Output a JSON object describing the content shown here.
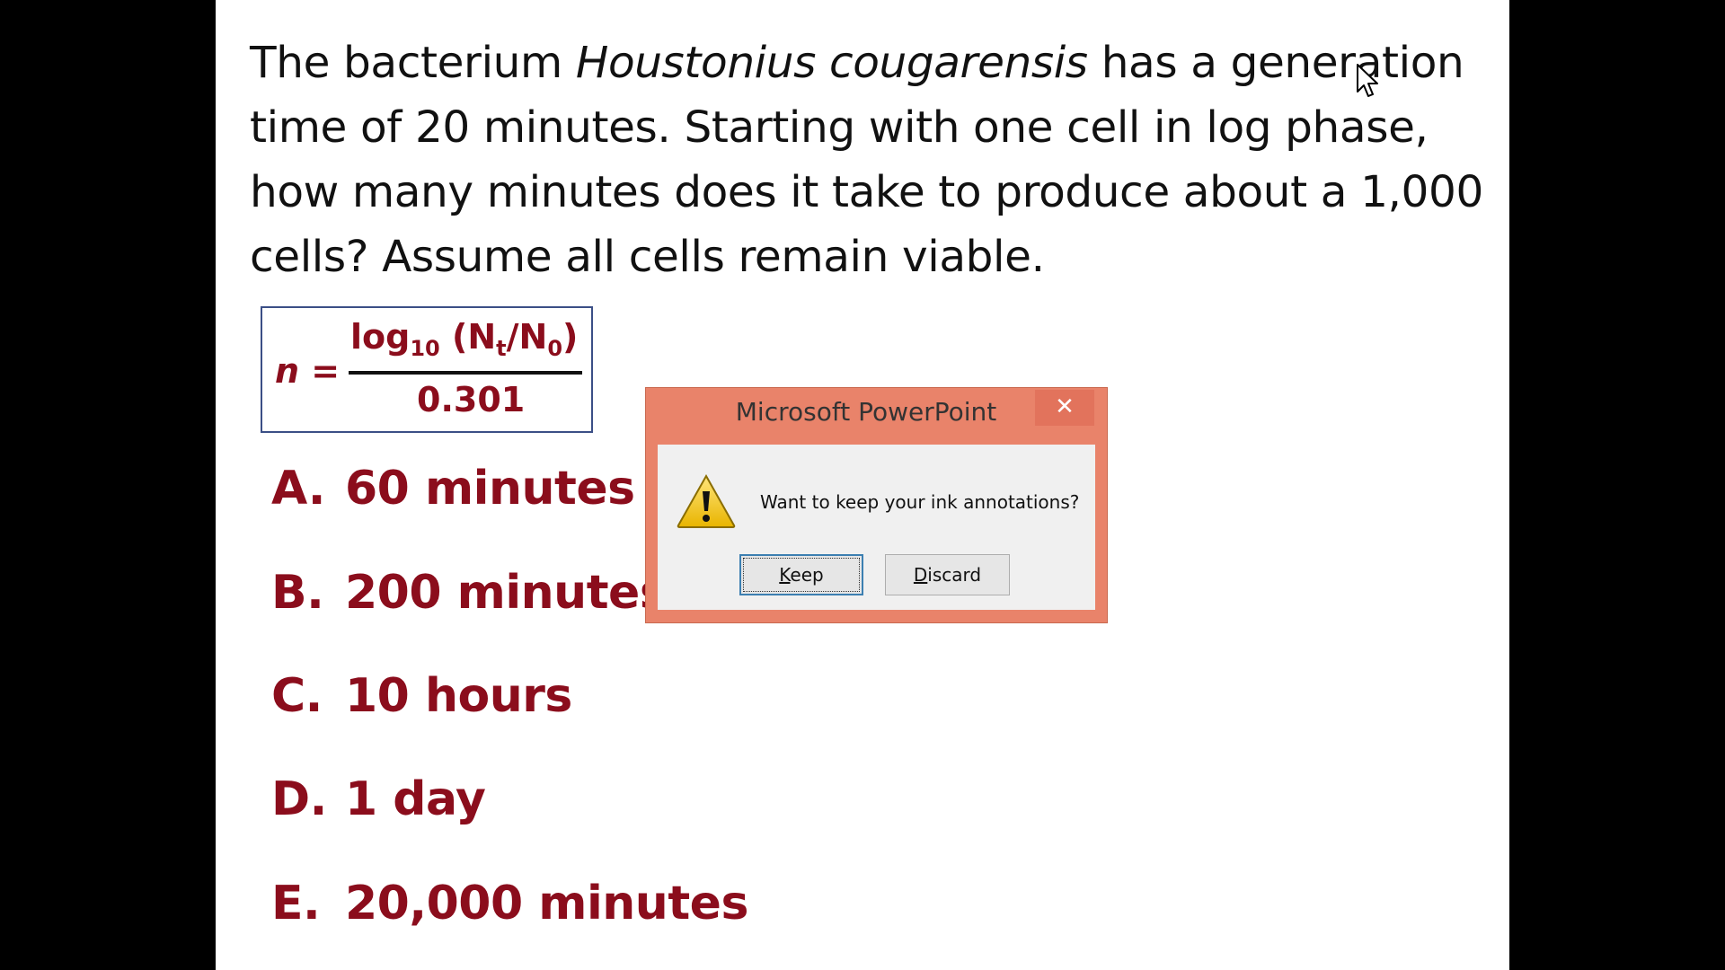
{
  "slide": {
    "question": {
      "part1": "The bacterium ",
      "organism": "Houstonius cougarensis",
      "part2": " has a generation time of 20 minutes.  Starting with one cell in log phase, how many minutes does it take to produce about a 1,000 cells?  Assume all cells remain viable."
    },
    "formula": {
      "lhs_var": "n",
      "lhs_eq": " =",
      "num_log": "log",
      "num_base": "10",
      "num_open": " (N",
      "num_sub_t": "t",
      "num_slash": "/N",
      "num_sub_0": "0",
      "num_close": ")",
      "denominator": "0.301"
    },
    "answers": [
      {
        "letter": "A.",
        "text": "60 minutes"
      },
      {
        "letter": "B.",
        "text": "200 minutes"
      },
      {
        "letter": "C.",
        "text": "10 hours"
      },
      {
        "letter": "D.",
        "text": "1 day"
      },
      {
        "letter": "E.",
        "text": "20,000 minutes"
      }
    ]
  },
  "dialog": {
    "title": "Microsoft PowerPoint",
    "close_glyph": "✕",
    "icon": "warning-icon",
    "message": "Want to keep your ink annotations?",
    "keep_access_key": "K",
    "keep_rest": "eep",
    "discard_access_key": "D",
    "discard_rest": "iscard"
  },
  "colors": {
    "answer_text": "#8b0d1c",
    "dialog_frame": "#e9836a",
    "formula_border": "#3b4f86"
  }
}
